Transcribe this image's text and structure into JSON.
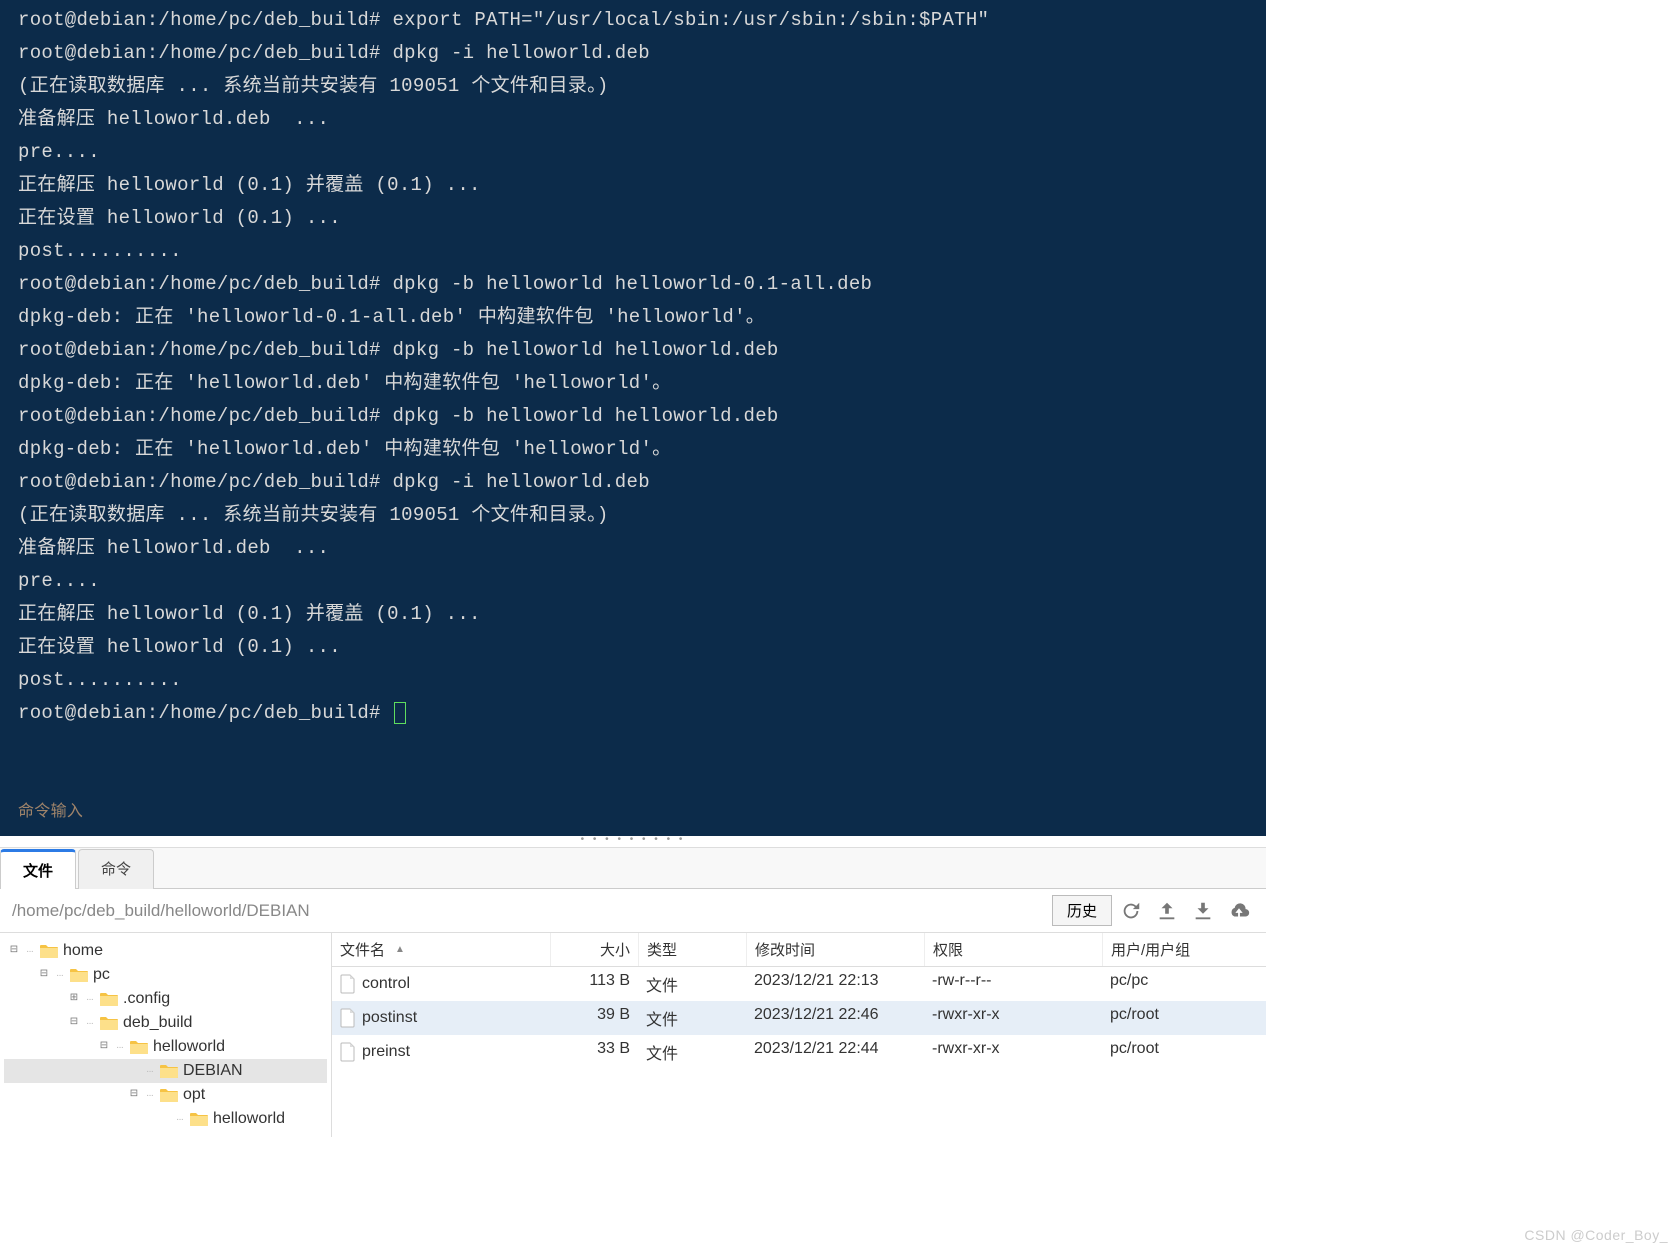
{
  "terminal": {
    "lines": [
      "root@debian:/home/pc/deb_build# export PATH=\"/usr/local/sbin:/usr/sbin:/sbin:$PATH\"",
      "root@debian:/home/pc/deb_build# dpkg -i helloworld.deb",
      "(正在读取数据库 ... 系统当前共安装有 109051 个文件和目录。)",
      "准备解压 helloworld.deb  ...",
      "pre....",
      "正在解压 helloworld (0.1) 并覆盖 (0.1) ...",
      "正在设置 helloworld (0.1) ...",
      "post..........",
      "root@debian:/home/pc/deb_build# dpkg -b helloworld helloworld-0.1-all.deb",
      "dpkg-deb: 正在 'helloworld-0.1-all.deb' 中构建软件包 'helloworld'。",
      "root@debian:/home/pc/deb_build# dpkg -b helloworld helloworld.deb",
      "dpkg-deb: 正在 'helloworld.deb' 中构建软件包 'helloworld'。",
      "root@debian:/home/pc/deb_build# dpkg -b helloworld helloworld.deb",
      "dpkg-deb: 正在 'helloworld.deb' 中构建软件包 'helloworld'。",
      "root@debian:/home/pc/deb_build# dpkg -i helloworld.deb",
      "(正在读取数据库 ... 系统当前共安装有 109051 个文件和目录。)",
      "准备解压 helloworld.deb  ...",
      "pre....",
      "正在解压 helloworld (0.1) 并覆盖 (0.1) ...",
      "正在设置 helloworld (0.1) ...",
      "post..........",
      "root@debian:/home/pc/deb_build# "
    ],
    "input_label": "命令输入"
  },
  "tabs": {
    "files": "文件",
    "commands": "命令"
  },
  "path": "/home/pc/deb_build/helloworld/DEBIAN",
  "history_label": "历史",
  "tree": [
    {
      "indent": 0,
      "toggle": "▢-",
      "name": "home"
    },
    {
      "indent": 1,
      "toggle": "▢-",
      "name": "pc"
    },
    {
      "indent": 2,
      "toggle": "▣+",
      "name": ".config"
    },
    {
      "indent": 2,
      "toggle": "▢-",
      "name": "deb_build"
    },
    {
      "indent": 3,
      "toggle": "▢-",
      "name": "helloworld"
    },
    {
      "indent": 4,
      "toggle": "",
      "name": "DEBIAN",
      "selected": true
    },
    {
      "indent": 4,
      "toggle": "▢-",
      "name": "opt"
    },
    {
      "indent": 5,
      "toggle": "",
      "name": "helloworld"
    }
  ],
  "columns": {
    "name": "文件名",
    "size": "大小",
    "type": "类型",
    "time": "修改时间",
    "perm": "权限",
    "user": "用户/用户组"
  },
  "files": [
    {
      "name": "control",
      "size": "113 B",
      "type": "文件",
      "time": "2023/12/21 22:13",
      "perm": "-rw-r--r--",
      "user": "pc/pc"
    },
    {
      "name": "postinst",
      "size": "39 B",
      "type": "文件",
      "time": "2023/12/21 22:46",
      "perm": "-rwxr-xr-x",
      "user": "pc/root",
      "selected": true
    },
    {
      "name": "preinst",
      "size": "33 B",
      "type": "文件",
      "time": "2023/12/21 22:44",
      "perm": "-rwxr-xr-x",
      "user": "pc/root"
    }
  ],
  "watermark": "CSDN @Coder_Boy_"
}
